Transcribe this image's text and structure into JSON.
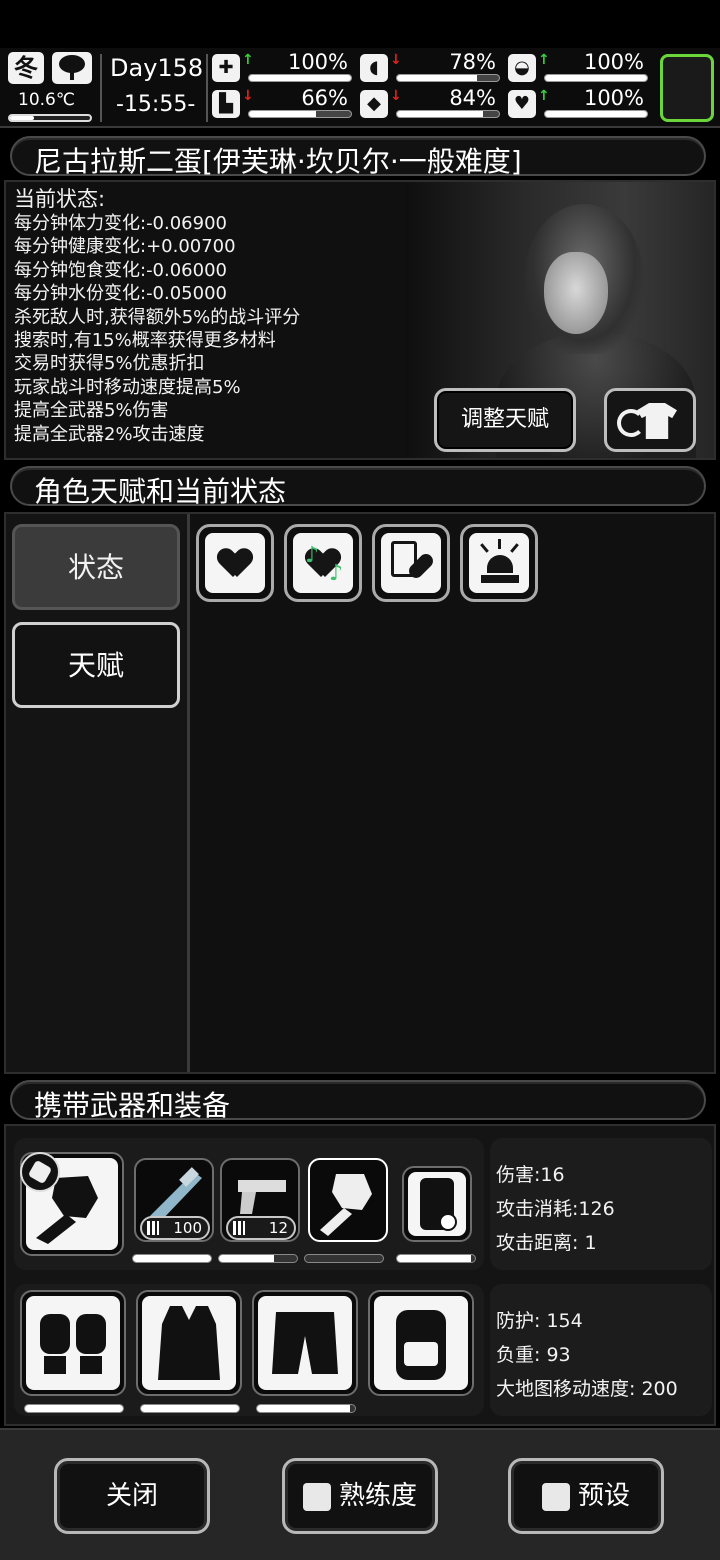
{
  "status_bar": {
    "season": "冬",
    "weather_icon": "cloud-tree-icon",
    "temperature": "10.6℃",
    "temperature_level": 0.3,
    "day": "Day158",
    "time": "-15:55-",
    "stats": [
      {
        "name": "health-kit-icon",
        "glyph": "✚",
        "trend": "up",
        "value": "100%",
        "level": 1.0
      },
      {
        "name": "stomach-icon",
        "glyph": "◖",
        "trend": "down",
        "value": "78%",
        "level": 0.78
      },
      {
        "name": "head-icon",
        "glyph": "◒",
        "trend": "up",
        "value": "100%",
        "level": 1.0
      },
      {
        "name": "boot-icon",
        "glyph": "▙",
        "trend": "down",
        "value": "66%",
        "level": 0.66
      },
      {
        "name": "water-drop-icon",
        "glyph": "◆",
        "trend": "down",
        "value": "84%",
        "level": 0.84
      },
      {
        "name": "heart-icon",
        "glyph": "♥",
        "trend": "up",
        "value": "100%",
        "level": 1.0
      }
    ],
    "trend_up_glyph": "↑",
    "trend_down_glyph": "↓",
    "accent_color": "#6ad63c"
  },
  "character": {
    "title": "尼古拉斯二蛋[伊芙琳·坎贝尔·一般难度]",
    "status_header": "当前状态:",
    "status_lines": [
      "每分钟体力变化:-0.06900",
      "每分钟健康变化:+0.00700",
      "每分钟饱食变化:-0.06000",
      "每分钟水份变化:-0.05000",
      "杀死敌人时,获得额外5%的战斗评分",
      "搜索时,有15%概率获得更多材料",
      "交易时获得5%优惠折扣",
      "玩家战斗时移动速度提高5%",
      "提高全武器5%伤害",
      "提高全武器2%攻击速度"
    ],
    "adjust_talent_label": "调整天赋",
    "outfit_icon": "change-outfit-icon"
  },
  "talents": {
    "section_title": "角色天赋和当前状态",
    "tabs": [
      {
        "label": "状态",
        "active": true
      },
      {
        "label": "天赋",
        "active": false
      }
    ],
    "status_icons": [
      "heart-status-icon",
      "music-heart-icon",
      "medicine-clipboard-icon",
      "alarm-siren-icon"
    ]
  },
  "equipment": {
    "section_title": "携带武器和装备",
    "weapons": [
      {
        "name": "fist-icon",
        "durability": 1.0
      },
      {
        "name": "rifle-icon",
        "ammo": "100",
        "durability": 1.0
      },
      {
        "name": "pistol-icon",
        "ammo": "12",
        "durability": 0.7
      },
      {
        "name": "fist-selected-icon",
        "durability": 0.0
      },
      {
        "name": "device-icon",
        "durability": 0.95
      }
    ],
    "gear": [
      {
        "name": "knee-pads-icon",
        "durability": 1.0
      },
      {
        "name": "tactical-vest-icon",
        "durability": 1.0
      },
      {
        "name": "fur-pants-icon",
        "durability": 0.95
      },
      {
        "name": "backpack-icon",
        "durability": null
      }
    ],
    "weapon_info": [
      {
        "label": "伤害",
        "value": "16",
        "text": "伤害:16"
      },
      {
        "label": "攻击消耗",
        "value": "126",
        "text": "攻击消耗:126"
      },
      {
        "label": "攻击距离",
        "value": "1",
        "text": "攻击距离: 1"
      }
    ],
    "gear_info": [
      {
        "label": "防护",
        "value": "154",
        "text": "防护: 154"
      },
      {
        "label": "负重",
        "value": "93",
        "text": "负重: 93"
      },
      {
        "label": "大地图移动速度",
        "value": "200",
        "text": "大地图移动速度: 200"
      }
    ]
  },
  "footer": {
    "close_label": "关闭",
    "proficiency_label": "熟练度",
    "preset_label": "预设"
  }
}
